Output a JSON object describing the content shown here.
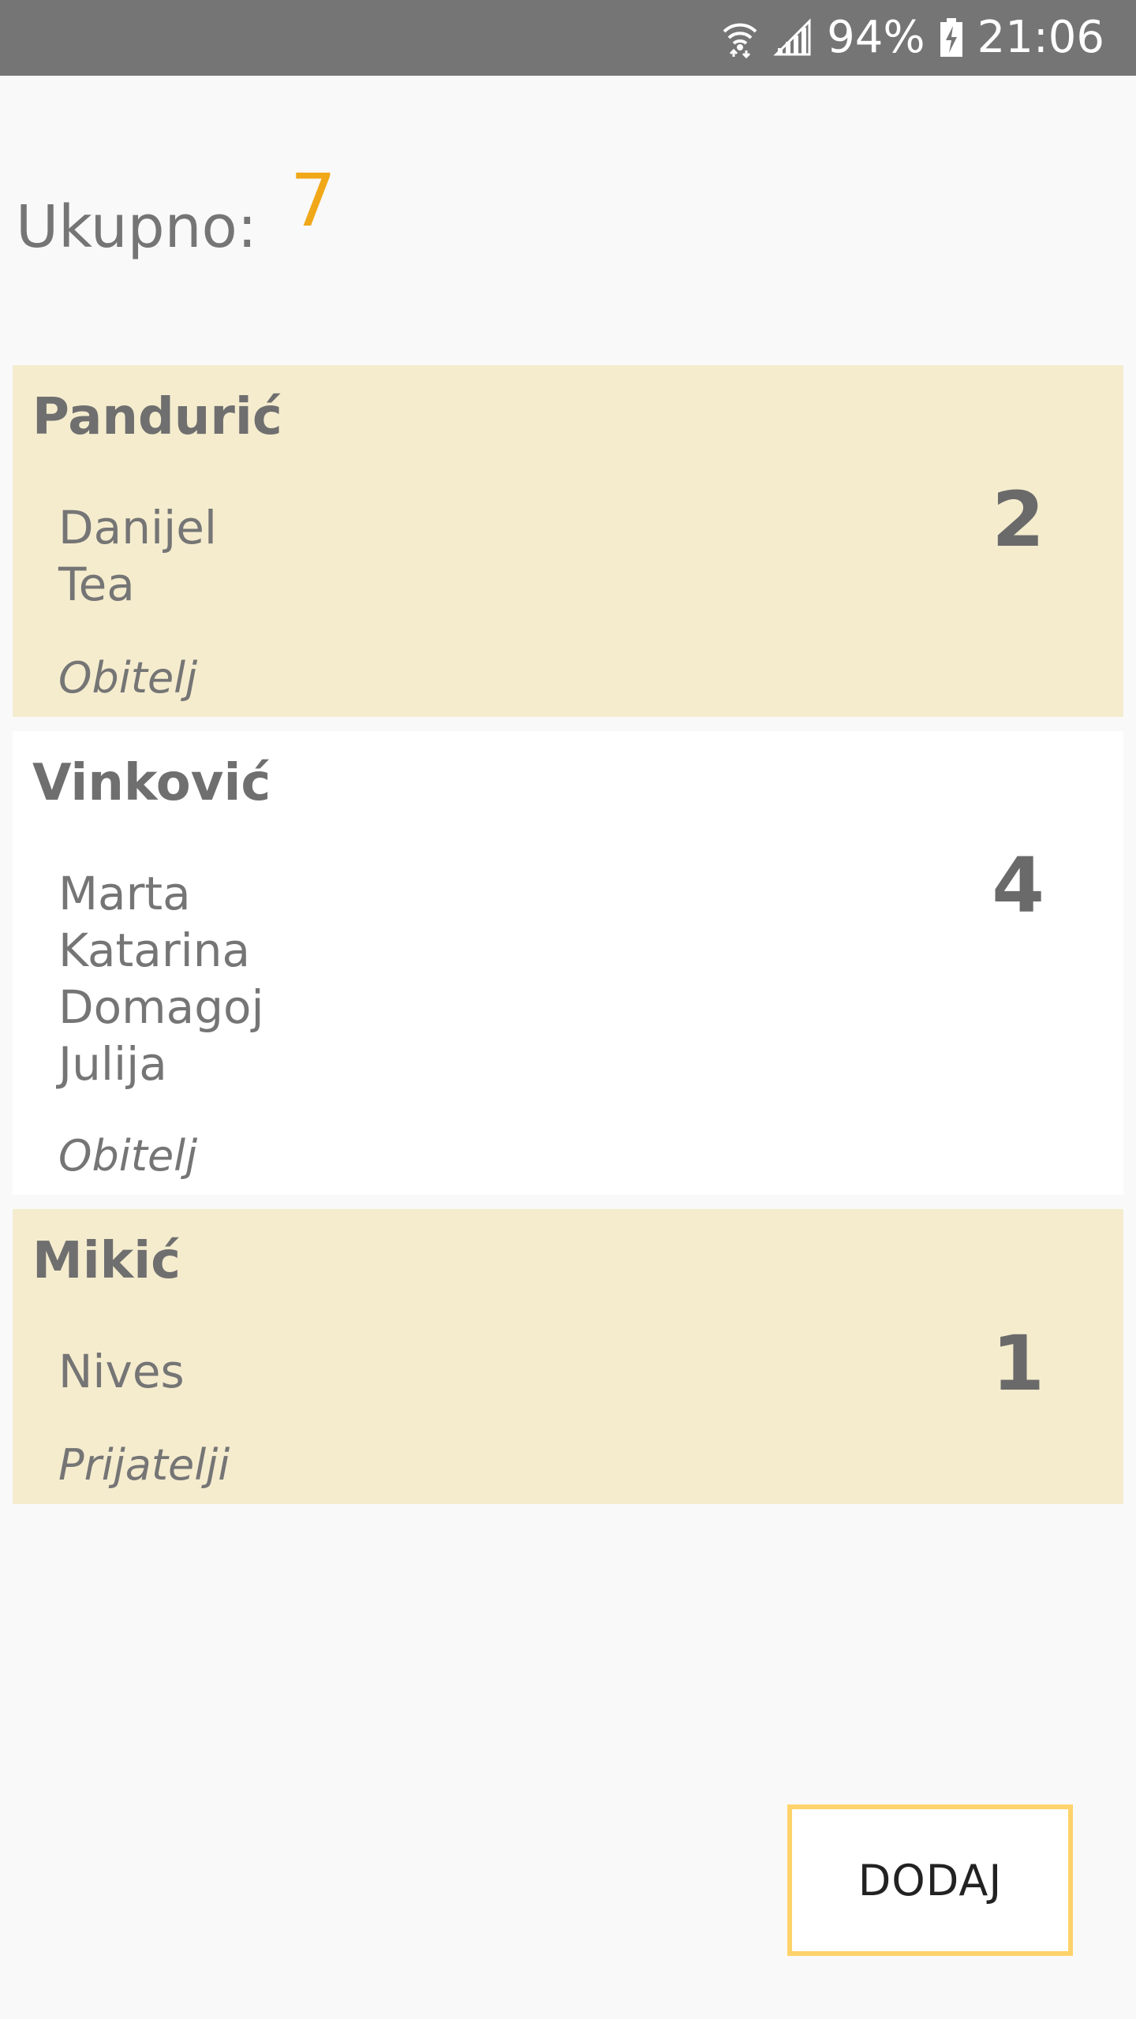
{
  "status_bar": {
    "battery": "94%",
    "time": "21:06",
    "icons": [
      "wifi-icon",
      "signal-icon",
      "battery-charging-icon"
    ]
  },
  "total": {
    "label": "Ukupno:",
    "value": "7"
  },
  "groups": [
    {
      "name": "Pandurić",
      "members": [
        "Danijel",
        "Tea"
      ],
      "count": "2",
      "type": "Obitelj"
    },
    {
      "name": "Vinković",
      "members": [
        "Marta",
        "Katarina",
        "Domagoj",
        "Julija"
      ],
      "count": "4",
      "type": "Obitelj"
    },
    {
      "name": "Mikić",
      "members": [
        "Nives"
      ],
      "count": "1",
      "type": "Prijatelji"
    }
  ],
  "add_button": {
    "label": "DODAJ"
  },
  "colors": {
    "status_bar": "#757575",
    "accent": "#f0a818",
    "card_highlight": "#f5ecce",
    "button_border": "#ffd36b"
  }
}
